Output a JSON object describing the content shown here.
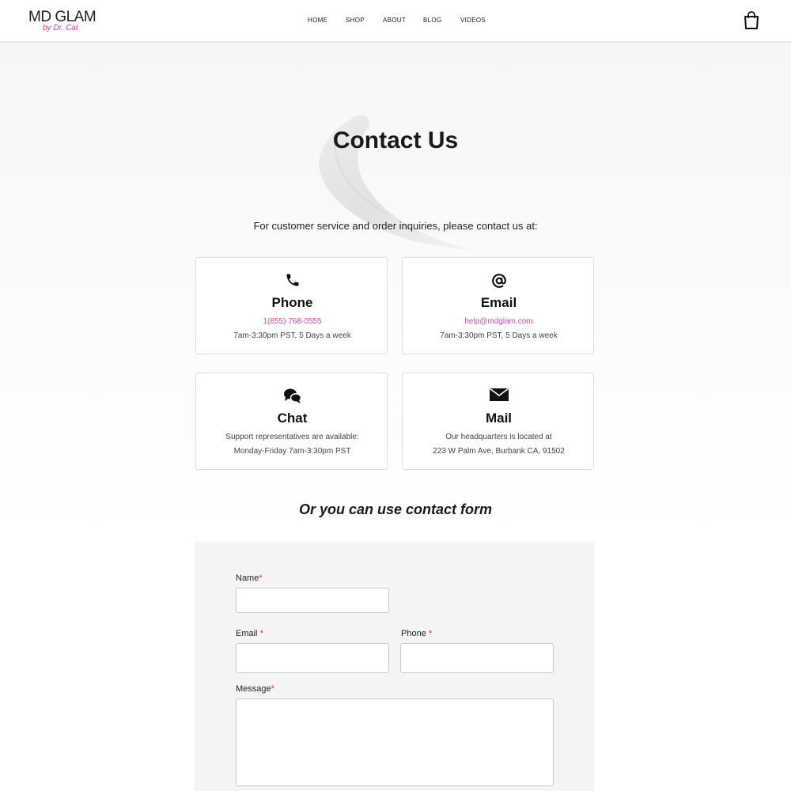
{
  "header": {
    "logo_main": "MD GLAM",
    "logo_sub": "by Dr. Cat",
    "nav": [
      "HOME",
      "SHOP",
      "ABOUT",
      "BLOG",
      "VIDEOS"
    ],
    "cart_icon": "shopping-bag-icon"
  },
  "hero": {
    "title": "Contact Us",
    "intro": "For customer service and order inquiries, please contact us at:"
  },
  "cards": {
    "phone": {
      "icon": "phone-icon",
      "title": "Phone",
      "line1": "1(855) 768-0555",
      "line2": "7am-3:30pm PST, 5 Days a week"
    },
    "email": {
      "icon": "at-sign-icon",
      "title": "Email",
      "line1": "help@mdglam.com",
      "line2": "7am-3:30pm PST, 5 Days a week"
    },
    "chat": {
      "icon": "chat-bubbles-icon",
      "title": "Chat",
      "line1": "Support representatives are available:",
      "line2": "Monday-Friday 7am-3:30pm PST"
    },
    "mail": {
      "icon": "envelope-icon",
      "title": "Mail",
      "line1": "Our headquarters is located at",
      "line2": "223 W Palm Ave, Burbank CA, 91502"
    }
  },
  "form": {
    "heading": "Or you can use contact form",
    "name_label": "Name",
    "email_label": "Email",
    "phone_label": "Phone",
    "message_label": "Message",
    "required_mark": "*",
    "name_value": "",
    "email_value": "",
    "phone_value": "",
    "message_value": ""
  },
  "colors": {
    "accent_pink": "#d04ab0",
    "required_red": "#d0392f",
    "form_bg": "#f4f4f4"
  }
}
